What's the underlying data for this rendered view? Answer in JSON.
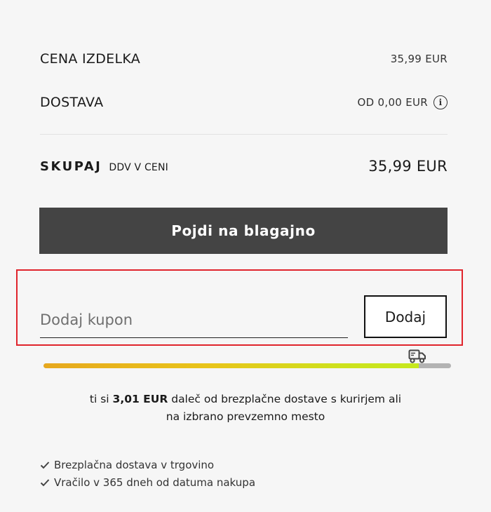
{
  "summary": {
    "price_label": "CENA IZDELKA",
    "price_value": "35,99 EUR",
    "shipping_label": "DOSTAVA",
    "shipping_value": "OD 0,00 EUR",
    "total_label": "SKUPAJ",
    "total_sub": "DDV V CENI",
    "total_value": "35,99 EUR"
  },
  "checkout": {
    "button_label": "Pojdi na blagajno"
  },
  "coupon": {
    "placeholder": "Dodaj kupon",
    "value": "",
    "button_label": "Dodaj"
  },
  "free_shipping": {
    "progress": 0.92,
    "msg_prefix": "ti si ",
    "amount": "3,01 EUR",
    "msg_suffix": " daleč od brezplačne dostave s kurirjem ali",
    "msg_line2": "na izbrano prevzemno mesto",
    "icon": "delivery-truck-icon"
  },
  "benefits": [
    "Brezplačna dostava v trgovino",
    "Vračilo v 365 dneh od datuma nakupa"
  ],
  "colors": {
    "checkout_bg": "#444444",
    "highlight_border": "#e0242c",
    "progress_start": "#e7a81e",
    "progress_end": "#c6e81e",
    "track": "#b3b3b3"
  }
}
